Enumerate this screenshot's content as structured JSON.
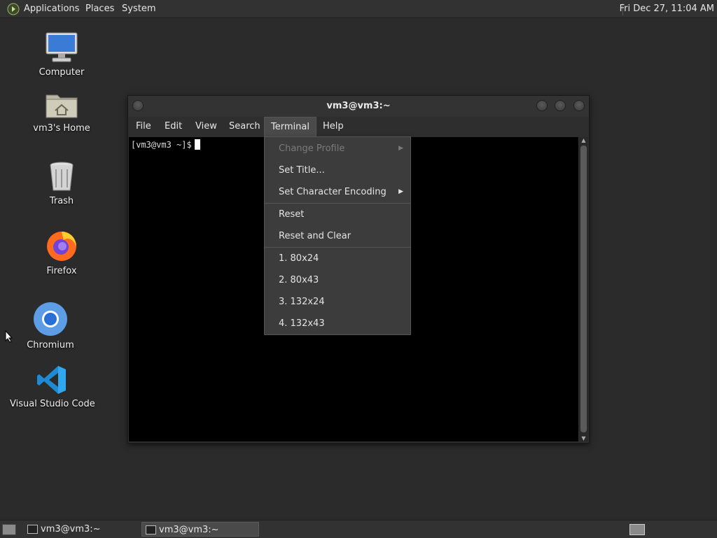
{
  "top_panel": {
    "menu": [
      "Applications",
      "Places",
      "System"
    ],
    "clock": "Fri Dec 27, 11:04 AM"
  },
  "desktop": {
    "icons": [
      {
        "label": "Computer",
        "icon": "monitor-icon"
      },
      {
        "label": "vm3's Home",
        "icon": "home-folder-icon"
      },
      {
        "label": "Trash",
        "icon": "trash-icon"
      },
      {
        "label": "Firefox",
        "icon": "firefox-icon"
      },
      {
        "label": "Chromium",
        "icon": "chromium-icon"
      },
      {
        "label": "Visual Studio Code",
        "icon": "vscode-icon"
      }
    ]
  },
  "terminal": {
    "title": "vm3@vm3:~",
    "menu": [
      "File",
      "Edit",
      "View",
      "Search",
      "Terminal",
      "Help"
    ],
    "active_menu": "Terminal",
    "prompt": "[vm3@vm3 ~]$"
  },
  "terminal_menu": {
    "items": [
      {
        "label": "Change Profile",
        "disabled": true,
        "submenu": true
      },
      {
        "label": "Set Title...",
        "disabled": false,
        "submenu": false
      },
      {
        "label": "Set Character Encoding",
        "disabled": false,
        "submenu": true
      },
      {
        "label": "Reset",
        "disabled": false,
        "submenu": false
      },
      {
        "label": "Reset and Clear",
        "disabled": false,
        "submenu": false
      },
      {
        "label": "1. 80x24",
        "disabled": false,
        "submenu": false
      },
      {
        "label": "2. 80x43",
        "disabled": false,
        "submenu": false
      },
      {
        "label": "3. 132x24",
        "disabled": false,
        "submenu": false
      },
      {
        "label": "4. 132x43",
        "disabled": false,
        "submenu": false
      }
    ]
  },
  "taskbar": {
    "tasks": [
      {
        "label": "vm3@vm3:~",
        "active": false
      },
      {
        "label": "vm3@vm3:~",
        "active": true
      }
    ]
  },
  "colors": {
    "desktop_bg": "#2b2b2b",
    "panel_bg": "#323232",
    "terminal_bg": "#000000",
    "menu_bg": "#3c3c3c"
  }
}
